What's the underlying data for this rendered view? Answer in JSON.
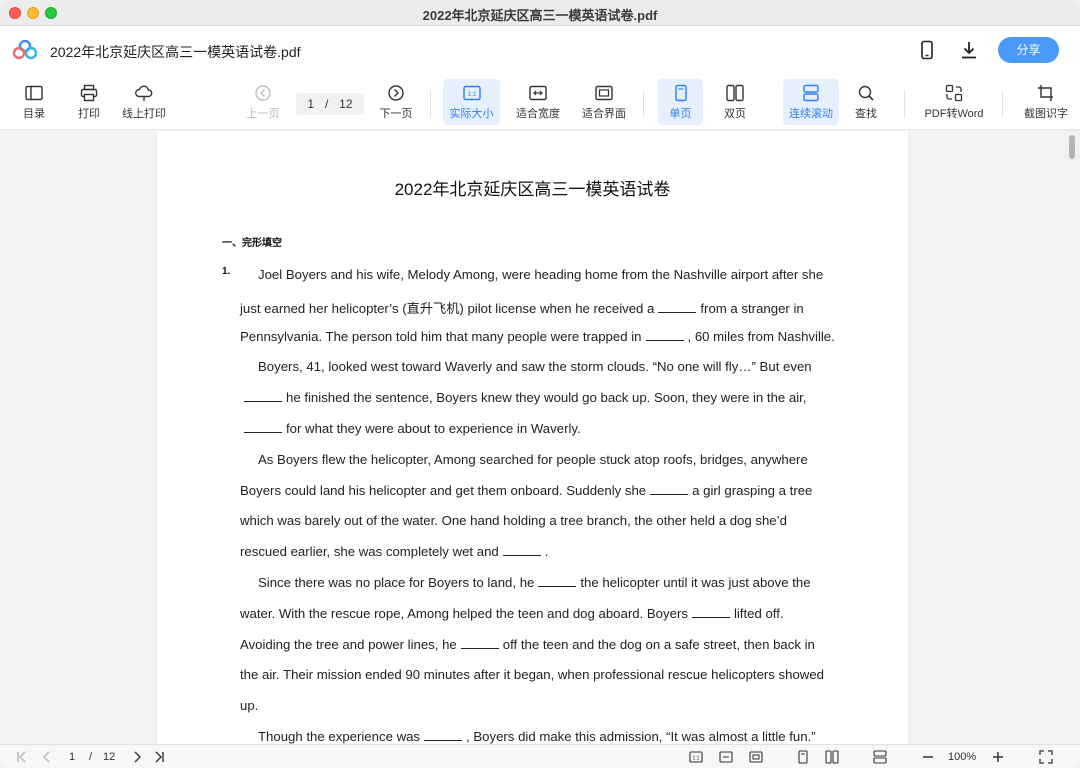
{
  "window": {
    "title": "2022年北京延庆区高三一模英语试卷.pdf"
  },
  "header": {
    "doc_title": "2022年北京延庆区高三一模英语试卷.pdf",
    "share_label": "分享",
    "icons": [
      "phone-icon",
      "download-icon"
    ]
  },
  "toolbar": {
    "toc": "目录",
    "print": "打印",
    "online_print": "线上打印",
    "prev_page": "上一页",
    "current_page": "1",
    "page_sep": "/",
    "total_pages": "12",
    "next_page": "下一页",
    "actual_size": "实际大小",
    "actual_size_glyph": "1:1",
    "fit_width": "适合宽度",
    "fit_page": "适合界面",
    "single_page": "单页",
    "double_page": "双页",
    "continuous_scroll": "连续滚动",
    "find": "查找",
    "pdf_to_word": "PDF转Word",
    "ocr_capture": "截图识字"
  },
  "document": {
    "title": "2022年北京延庆区高三一模英语试卷",
    "section_heading": "一、完形填空",
    "question_number": "1.",
    "lines": [
      {
        "indent": true,
        "segments": [
          "Joel Boyers and his wife, Melody Among, were heading home from the Nashville airport after she"
        ]
      },
      {
        "indent": false,
        "segments": [
          "just earned her helicopter’s (直升飞机) pilot license when he received a",
          "BLANK",
          "from a stranger in"
        ]
      },
      {
        "indent": false,
        "segments": [
          "Pennsylvania. The person told him that many people were trapped in",
          "BLANK",
          ", 60 miles from Nashville."
        ]
      },
      {
        "indent": true,
        "segments": [
          "Boyers, 41, looked west toward Waverly and saw the storm clouds. “No one will fly…” But even"
        ]
      },
      {
        "indent": false,
        "segments": [
          "BLANK",
          "he finished the sentence, Boyers knew they would go back up. Soon, they were in the air,"
        ]
      },
      {
        "indent": false,
        "segments": [
          "BLANK",
          "for what they were about to experience in Waverly."
        ]
      },
      {
        "indent": true,
        "segments": [
          "As Boyers flew the helicopter, Among searched for people stuck atop roofs, bridges, anywhere"
        ]
      },
      {
        "indent": false,
        "segments": [
          "Boyers could land his helicopter and get them onboard. Suddenly she",
          "BLANK",
          "a girl grasping a tree"
        ]
      },
      {
        "indent": false,
        "segments": [
          "which was barely out of the water. One hand holding a tree branch, the other held a dog she’d"
        ]
      },
      {
        "indent": false,
        "segments": [
          "rescued earlier, she was completely wet and",
          "BLANK",
          "."
        ]
      },
      {
        "indent": true,
        "segments": [
          "Since there was no place for Boyers to land, he",
          "BLANK",
          "the helicopter until it was just above the"
        ]
      },
      {
        "indent": false,
        "segments": [
          "water. With the rescue rope, Among helped the teen and dog aboard. Boyers",
          "BLANK",
          "lifted off."
        ]
      },
      {
        "indent": false,
        "segments": [
          "Avoiding the tree and power lines, he",
          "BLANK",
          "off the teen and the dog on a safe street, then back in"
        ]
      },
      {
        "indent": false,
        "segments": [
          "the air. Their mission ended 90 minutes after it began, when professional rescue helicopters showed"
        ]
      },
      {
        "indent": false,
        "segments": [
          "up."
        ]
      },
      {
        "indent": true,
        "segments": [
          "Though the experience was",
          "BLANK",
          ", Boyers did make this admission, “It was almost a little fun.”"
        ]
      }
    ]
  },
  "statusbar": {
    "current_page": "1",
    "page_sep": "/",
    "total_pages": "12",
    "zoom": "100%",
    "actual_size_glyph": "1:1"
  }
}
